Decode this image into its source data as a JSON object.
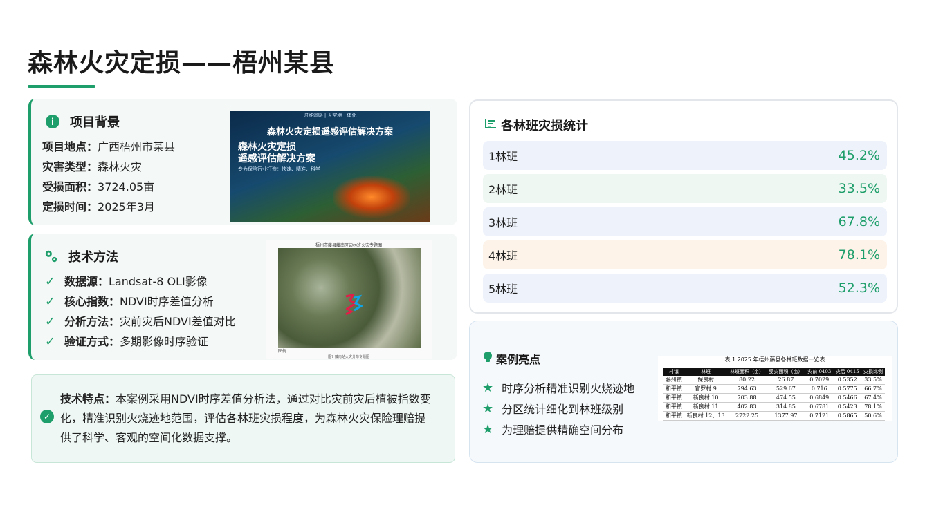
{
  "title": "森林火灾定损——梧州某县",
  "background": {
    "heading": "项目背景",
    "rows": [
      {
        "key": "项目地点：",
        "value": "广西梧州市某县"
      },
      {
        "key": "灾害类型：",
        "value": "森林火灾"
      },
      {
        "key": "受损面积：",
        "value": "3724.05亩"
      },
      {
        "key": "定损时间：",
        "value": "2025年3月"
      }
    ]
  },
  "promo_image": {
    "top_text": "时维遥感 | 天空地一体化",
    "title": "森林火灾定损遥感评估解决方案",
    "big_line1": "森林火灾定损",
    "big_line2": "遥感评估解决方案",
    "sub": "专为保险行业打造：快速、精准、科学"
  },
  "method": {
    "heading": "技术方法",
    "rows": [
      {
        "key": "数据源：",
        "value": "Landsat-8 OLI影像"
      },
      {
        "key": "核心指数：",
        "value": "NDVI时序差值分析"
      },
      {
        "key": "分析方法：",
        "value": "灾前灾后NDVI差值对比"
      },
      {
        "key": "验证方式：",
        "value": "多期影像时序验证"
      }
    ]
  },
  "map_image": {
    "title": "梧州市藤县藤南区边林班火灾专题图",
    "legend": "图例",
    "caption": "图7 藤南站火灾分布专题图"
  },
  "feature": {
    "label": "技术特点：",
    "text": "本案例采用NDVI时序差值分析法，通过对比灾前灾后植被指数变化，精准识别火烧迹地范围，评估各林班灾损程度，为森林火灾保险理赔提供了科学、客观的空间化数据支撑。"
  },
  "stats": {
    "heading": "各林班灾损统计",
    "rows": [
      {
        "label": "1林班",
        "value": "45.2%",
        "bg": "#eef3fb"
      },
      {
        "label": "2林班",
        "value": "33.5%",
        "bg": "#eef7f2"
      },
      {
        "label": "3林班",
        "value": "67.8%",
        "bg": "#eef3fb"
      },
      {
        "label": "4林班",
        "value": "78.1%",
        "bg": "#fdf3e9"
      },
      {
        "label": "5林班",
        "value": "52.3%",
        "bg": "#eef3fb"
      }
    ]
  },
  "cases": {
    "heading": "案例亮点",
    "items": [
      "时序分析精准识别火烧迹地",
      "分区统计细化到林班级别",
      "为理赔提供精确空间分布"
    ]
  },
  "table": {
    "caption": "表 1 2025 年梧州藤县各林班数据一览表",
    "headers": [
      "村镇",
      "林班",
      "林班面积（亩）",
      "受灾面积（亩）",
      "灾前 0403",
      "灾后 0415",
      "灾损比例"
    ],
    "rows": [
      [
        "藤州镇",
        "保良村",
        "80.22",
        "26.87",
        "0.7029",
        "0.5352",
        "33.5%"
      ],
      [
        "和平镇",
        "官罗村 9",
        "794.63",
        "529.67",
        "0.716",
        "0.5775",
        "66.7%"
      ],
      [
        "和平镇",
        "新良村 10",
        "703.88",
        "474.55",
        "0.6849",
        "0.5466",
        "67.4%"
      ],
      [
        "和平镇",
        "新良村 11",
        "402.83",
        "314.85",
        "0.6781",
        "0.5423",
        "78.1%"
      ],
      [
        "和平镇",
        "新良村 12、13",
        "2722.25",
        "1377.97",
        "0.7121",
        "0.5865",
        "50.6%"
      ]
    ]
  },
  "colors": {
    "accent": "#1e9e6a"
  }
}
